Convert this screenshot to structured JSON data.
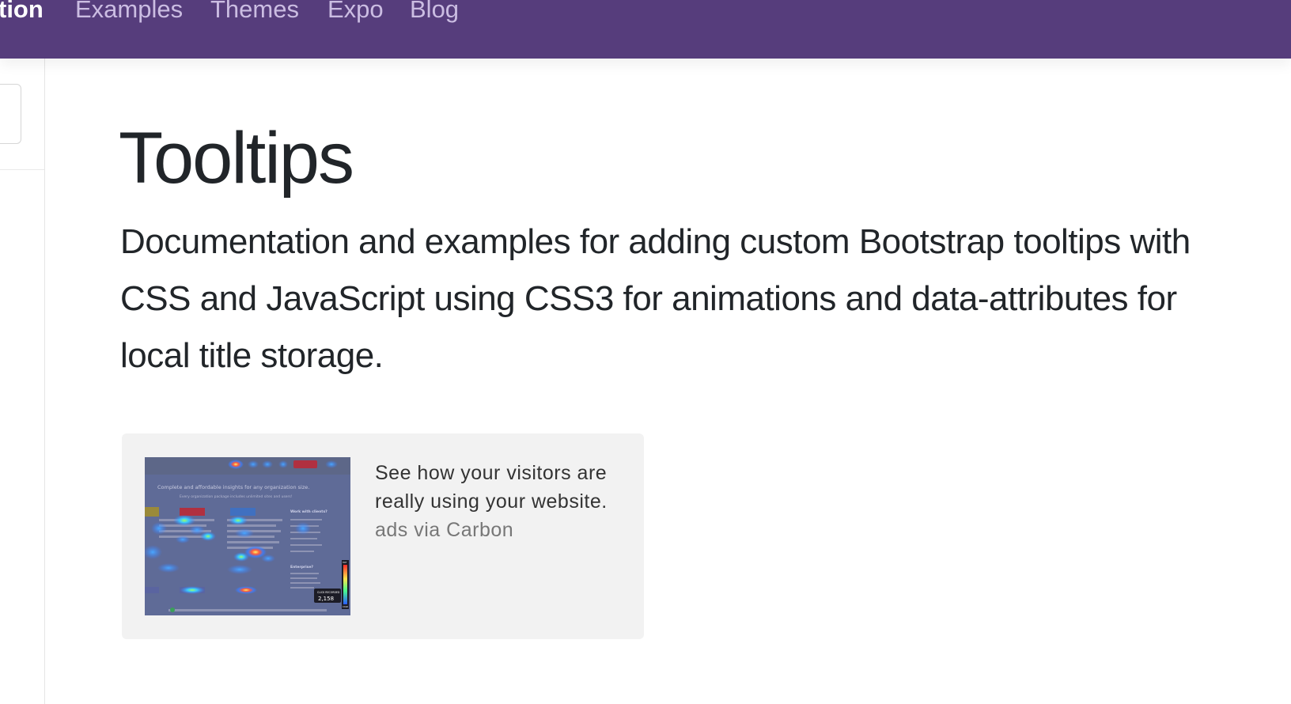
{
  "navbar": {
    "items": [
      {
        "label": "tion",
        "active": true
      },
      {
        "label": "Examples",
        "active": false
      },
      {
        "label": "Themes",
        "active": false
      },
      {
        "label": "Expo",
        "active": false
      },
      {
        "label": "Blog",
        "active": false
      }
    ],
    "background": "#563d7c",
    "link_color": "#cbbde2",
    "active_color": "#ffffff"
  },
  "page": {
    "title": "Tooltips",
    "lead": "Documentation and examples for adding custom Bootstrap tooltips with CSS and JavaScript using CSS3 for animations and data-attributes for local title storage."
  },
  "carbon_ad": {
    "text": "See how your visitors are really using your website.",
    "powered_by": "ads via Carbon",
    "image": {
      "headline": "Complete and affordable insights for any organization size.",
      "subline": "Every organization package includes unlimited sites and users!",
      "side_title": "Work with clients?",
      "enterprise_label": "Enterprise?",
      "click_label": "CLICK RECORDED",
      "click_count": "2,158",
      "scale_top": "HOT",
      "scale_bottom": "COLD"
    },
    "background": "#f2f2f2"
  }
}
